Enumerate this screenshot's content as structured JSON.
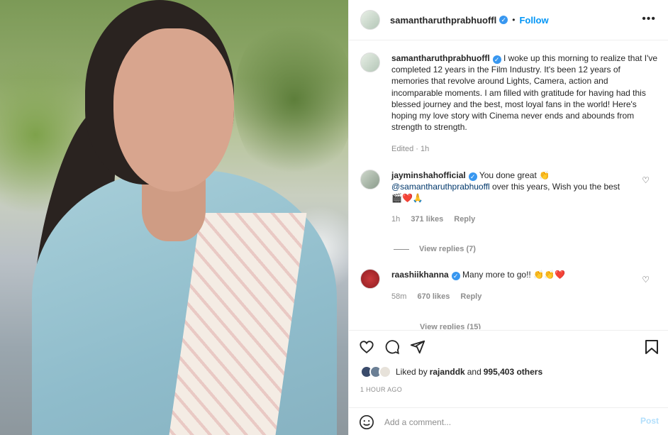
{
  "header": {
    "username": "samantharuthprabhuoffl",
    "separator": "•",
    "follow_label": "Follow",
    "more_label": "•••"
  },
  "caption": {
    "username": "samantharuthprabhuoffl",
    "text": "I woke up this morning to realize that I've completed 12 years in the Film Industry. It's been 12 years of memories that revolve around Lights, Camera, action and incomparable moments. I am filled with gratitude for having had this blessed journey and the best, most loyal fans in the world! Here's hoping my love story with Cinema never ends and abounds from strength to strength.",
    "meta": "Edited · 1h"
  },
  "comments": [
    {
      "username": "jayminshahofficial",
      "text_start": "You done great 👏",
      "mention": "@samantharuthprabhuoffl",
      "text_end": " over this years, Wish you the best",
      "emoji_line": "🎬❤️🙏",
      "time": "1h",
      "likes": "371 likes",
      "reply": "Reply",
      "view_replies": "View replies (7)"
    },
    {
      "username": "raashiikhanna",
      "text": "Many more to go!! 👏👏❤️",
      "time": "58m",
      "likes": "670 likes",
      "reply": "Reply",
      "view_replies": "View replies (15)"
    }
  ],
  "likes": {
    "prefix": "Liked by",
    "user": "rajanddk",
    "and": "and",
    "count": "995,403 others"
  },
  "time_ago": "1 HOUR AGO",
  "add_comment": {
    "placeholder": "Add a comment...",
    "post_label": "Post"
  },
  "colors": {
    "accent": "#0095f6",
    "verified": "#3897f0",
    "muted": "#8e8e8e",
    "post_disabled": "#b2dffc"
  },
  "icons": [
    "heart-icon",
    "comment-icon",
    "share-icon",
    "bookmark-icon",
    "emoji-icon",
    "more-icon",
    "verified-icon"
  ]
}
